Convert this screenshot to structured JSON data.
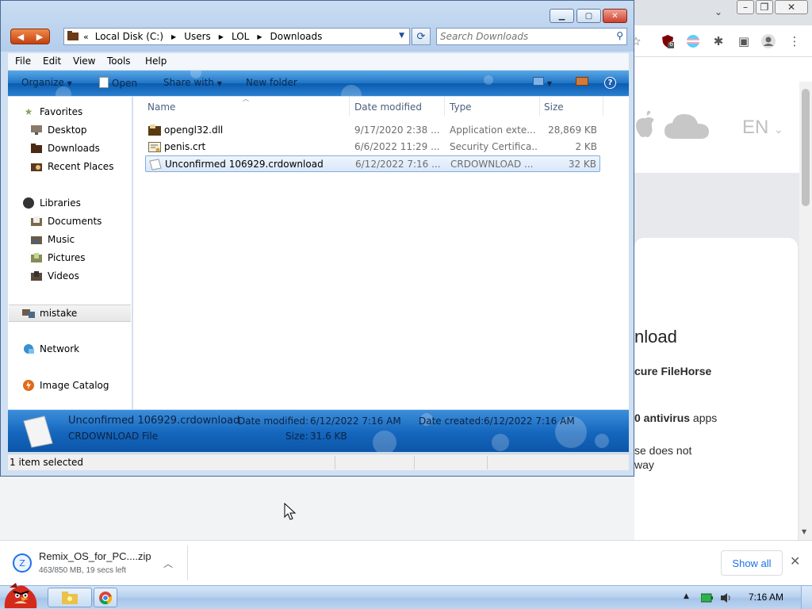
{
  "browser": {
    "page_lang": "EN",
    "texts": {
      "heading_fragment": "nload",
      "line1_fragment": "cure FileHorse",
      "line2_bold": "0 antivirus",
      "line2_rest": " apps",
      "line3": "se does not",
      "line4": "way"
    },
    "extension_badge": "6",
    "download": {
      "filename": "Remix_OS_for_PC....zip",
      "progress": "463/850 MB, 19 secs left",
      "show_all": "Show all"
    }
  },
  "explorer": {
    "breadcrumb": [
      "Local Disk (C:)",
      "Users",
      "LOL",
      "Downloads"
    ],
    "search_placeholder": "Search Downloads",
    "menu": [
      "File",
      "Edit",
      "View",
      "Tools",
      "Help"
    ],
    "commands": {
      "organize": "Organize",
      "open": "Open",
      "share_with": "Share with",
      "new_folder": "New folder"
    },
    "nav": {
      "favorites": "Favorites",
      "desktop": "Desktop",
      "downloads": "Downloads",
      "recent": "Recent Places",
      "libraries": "Libraries",
      "documents": "Documents",
      "music": "Music",
      "pictures": "Pictures",
      "videos": "Videos",
      "mistake": "mistake",
      "network": "Network",
      "image_catalog": "Image Catalog"
    },
    "columns": {
      "name": "Name",
      "date": "Date modified",
      "type": "Type",
      "size": "Size"
    },
    "files": [
      {
        "name": "opengl32.dll",
        "date": "9/17/2020 2:38 ...",
        "type": "Application exte...",
        "size": "28,869 KB"
      },
      {
        "name": "penis.crt",
        "date": "6/6/2022 11:29 ...",
        "type": "Security Certifica...",
        "size": "2 KB"
      },
      {
        "name": "Unconfirmed 106929.crdownload",
        "date": "6/12/2022 7:16 ...",
        "type": "CRDOWNLOAD ...",
        "size": "32 KB"
      }
    ],
    "details": {
      "filename": "Unconfirmed 106929.crdownload",
      "filetype": "CRDOWNLOAD File",
      "modified_label": "Date modified:",
      "modified_value": "6/12/2022 7:16 AM",
      "created_label": "Date created:",
      "created_value": "6/12/2022 7:16 AM",
      "size_label": "Size:",
      "size_value": "31.6 KB"
    },
    "status": "1 item selected"
  },
  "taskbar": {
    "clock": "7:16 AM"
  }
}
